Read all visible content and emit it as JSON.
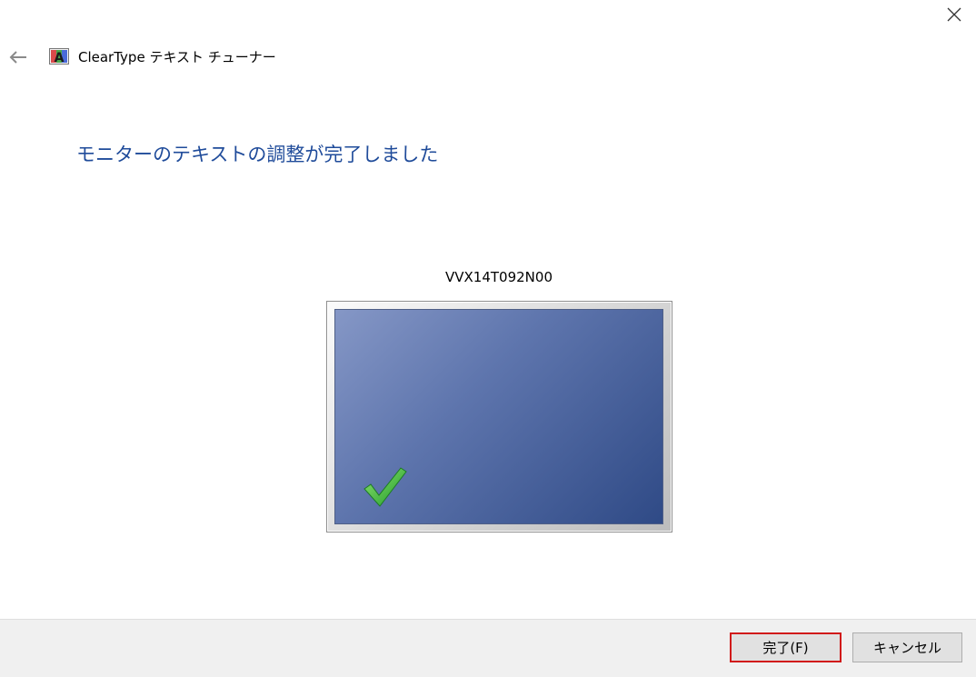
{
  "window": {
    "title": "ClearType テキスト チューナー",
    "icons": {
      "close": "close-icon",
      "back": "arrow-left-icon",
      "app": "cleartype-icon"
    }
  },
  "content": {
    "heading": "モニターのテキストの調整が完了しました",
    "monitor_name": "VVX14T092N00",
    "status_icon": "checkmark-icon"
  },
  "footer": {
    "finish_label": "完了(F)",
    "cancel_label": "キャンセル"
  },
  "colors": {
    "heading": "#1f4b9a",
    "highlight_border": "#d11a1a",
    "check": "#3db53d"
  }
}
